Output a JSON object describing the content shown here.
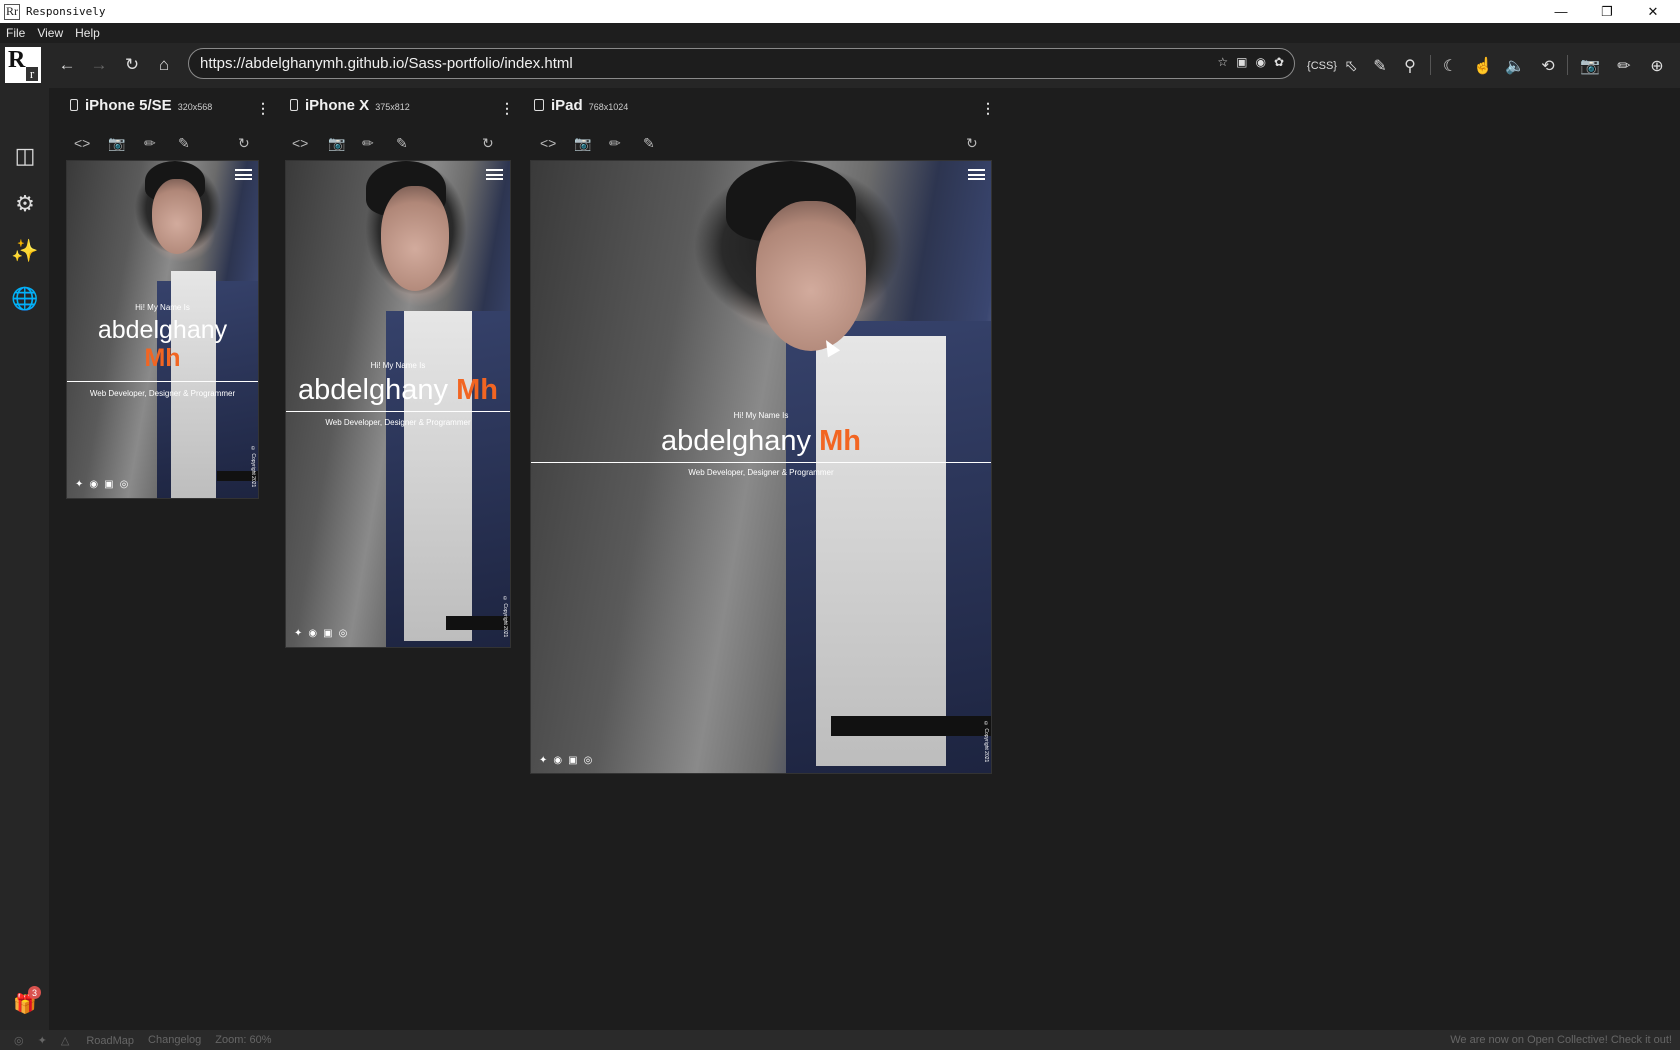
{
  "window": {
    "title": "Responsively",
    "app_icon": "Rr"
  },
  "menu": [
    "File",
    "View",
    "Help"
  ],
  "toolbar": {
    "logo": "R",
    "url": "https://abdelghanymh.github.io/Sass-portfolio/index.html",
    "css_label": "{CSS}"
  },
  "devices": [
    {
      "name": "iPhone 5/SE",
      "size": "320x568"
    },
    {
      "name": "iPhone X",
      "size": "375x812"
    },
    {
      "name": "iPad",
      "size": "768x1024"
    }
  ],
  "site": {
    "greeting": "Hi! My Name Is",
    "name_first": "abdelghany",
    "name_highlight": "Mh",
    "role": "Web Developer, Designer & Programmer",
    "copyright": "© Copyright 2021",
    "highlight_color": "#f26522"
  },
  "sidebar": {
    "gift_badge": "3"
  },
  "statusbar": {
    "roadmap": "RoadMap",
    "changelog": "Changelog",
    "zoom": "Zoom: 60%",
    "notice": "We are now on Open Collective! Check it out!"
  }
}
